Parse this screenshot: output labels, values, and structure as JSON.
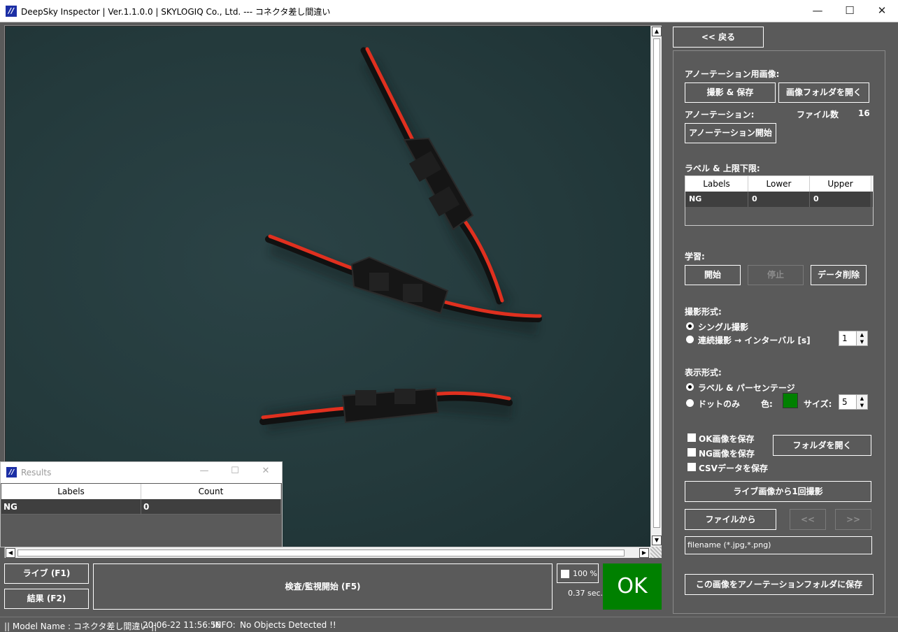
{
  "window": {
    "title": "DeepSky Inspector | Ver.1.1.0.0 | SKYLOGIQ Co., Ltd. --- コネクタ差し間違い",
    "app_icon": "//",
    "min": "—",
    "max": "☐",
    "close": "✕"
  },
  "viewport": {
    "scroll_up": "▲",
    "scroll_down": "▼",
    "scroll_left": "◀",
    "scroll_right": "▶"
  },
  "results_window": {
    "title": "Results",
    "icon": "//",
    "min": "—",
    "max": "☐",
    "close": "✕",
    "columns": [
      "Labels",
      "Count"
    ],
    "rows": [
      {
        "label": "NG",
        "count": "0"
      }
    ]
  },
  "bottom": {
    "live_button": "ライブ (F1)",
    "result_button": "結果 (F2)",
    "inspect_button": "検査/監視開始 (F5)",
    "zoom_label": "100 %",
    "elapsed": "0.37 sec.",
    "verdict": "OK",
    "verdict_color": "#008000"
  },
  "statusbar": {
    "model": "|| Model Name : コネクタ差し間違い ||",
    "datetime": "20-06-22 11:56:56",
    "info_label": "INFO:",
    "info_text": "No Objects Detected !!"
  },
  "panel": {
    "back_button": "<< 戻る",
    "annotation_image_label": "アノーテーション用画像:",
    "capture_save_button": "撮影 & 保存",
    "open_image_folder_button": "画像フォルダを開く",
    "annotation_label": "アノーテーション:",
    "file_count_label": "ファイル数",
    "file_count": "16",
    "start_annotation_button": "アノーテーション開始",
    "label_limits_label": "ラベル & 上限下限:",
    "label_table": {
      "columns": [
        "Labels",
        "Lower",
        "Upper"
      ],
      "rows": [
        {
          "label": "NG",
          "lower": "0",
          "upper": "0"
        }
      ]
    },
    "learning_label": "学習:",
    "start_button": "開始",
    "stop_button": "停止",
    "delete_data_button": "データ削除",
    "capture_mode_label": "撮影形式:",
    "single_capture": "シングル撮影",
    "continuous_capture": "連続撮影 → インターバル [s]",
    "interval_value": "1",
    "display_mode_label": "表示形式:",
    "label_percentage": "ラベル & パーセンテージ",
    "dots_only": "ドットのみ",
    "color_label": "色:",
    "size_label": "サイズ:",
    "size_value": "5",
    "dot_color": "#008000",
    "save_ok_images": "OK画像を保存",
    "save_ng_images": "NG画像を保存",
    "save_csv": "CSVデータを保存",
    "open_folder_button": "フォルダを開く",
    "capture_from_live_button": "ライブ画像から1回撮影",
    "from_file_button": "ファイルから",
    "prev_button": "<<",
    "next_button": ">>",
    "filename_placeholder": "filename (*.jpg,*.png)",
    "save_to_annotation_button": "この画像をアノーテーションフォルダに保存"
  }
}
